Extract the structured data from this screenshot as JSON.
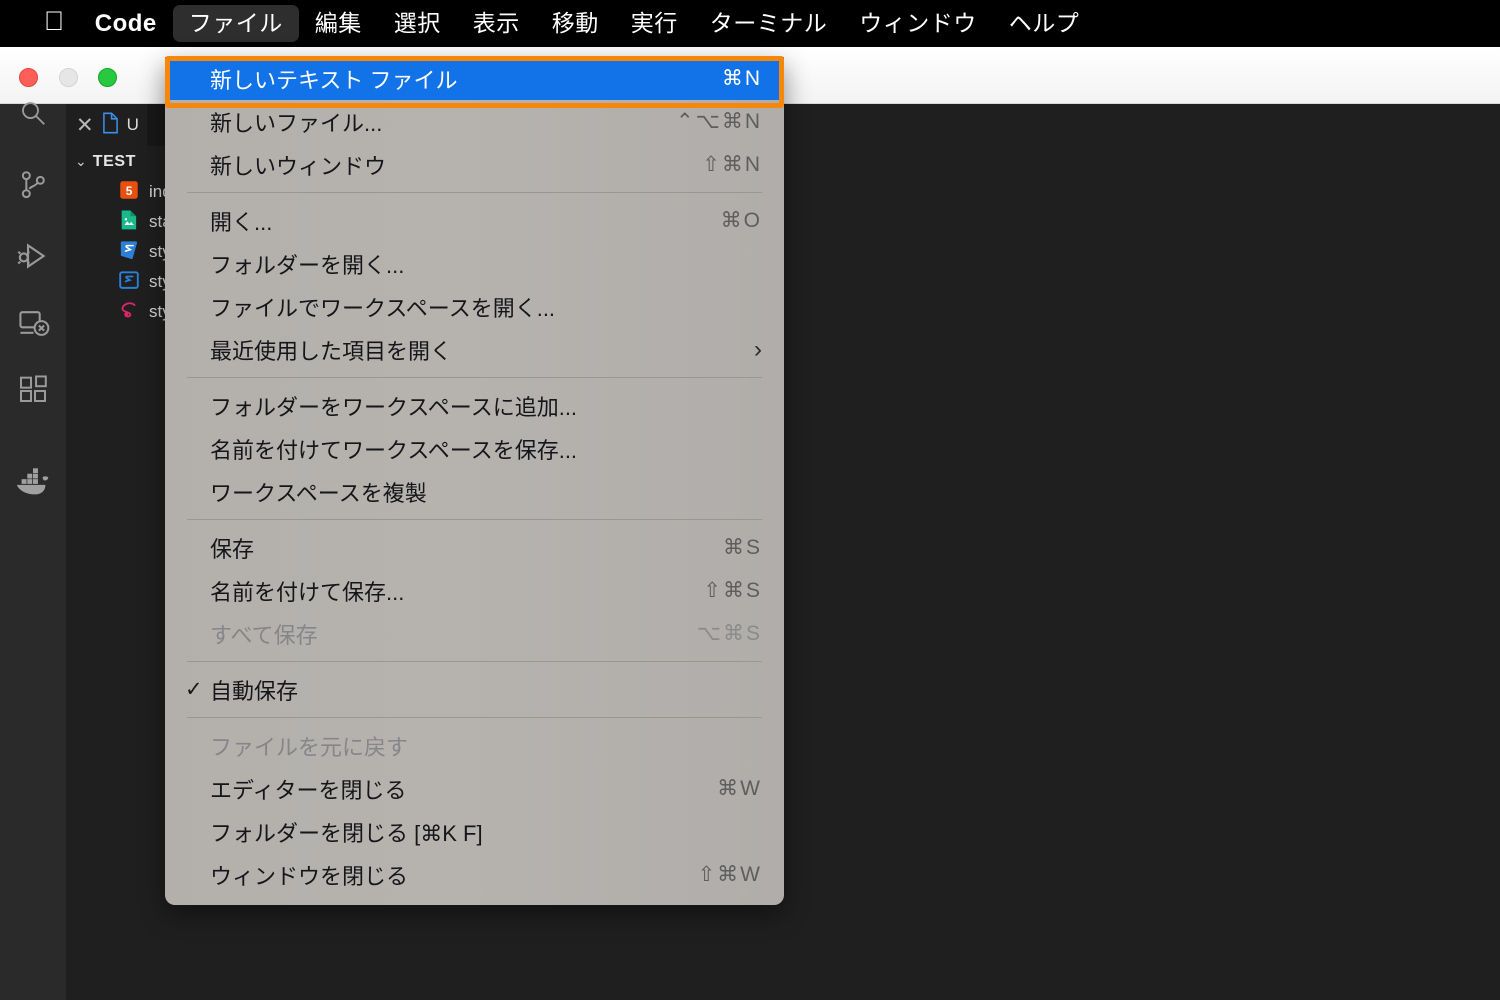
{
  "menubar": {
    "apple_icon": "apple-logo-icon",
    "items": [
      {
        "label": "Code",
        "strong": true,
        "active": false
      },
      {
        "label": "ファイル",
        "strong": false,
        "active": true
      },
      {
        "label": "編集",
        "strong": false,
        "active": false
      },
      {
        "label": "選択",
        "strong": false,
        "active": false
      },
      {
        "label": "表示",
        "strong": false,
        "active": false
      },
      {
        "label": "移動",
        "strong": false,
        "active": false
      },
      {
        "label": "実行",
        "strong": false,
        "active": false
      },
      {
        "label": "ターミナル",
        "strong": false,
        "active": false
      },
      {
        "label": "ウィンドウ",
        "strong": false,
        "active": false
      },
      {
        "label": "ヘルプ",
        "strong": false,
        "active": false
      }
    ]
  },
  "window": {
    "traffic_lights": [
      "close-button",
      "minimize-button",
      "zoom-button"
    ],
    "tab": {
      "close_icon": "✕",
      "file_icon": "text-file-icon",
      "label": "U"
    }
  },
  "activitybar": {
    "icons": [
      "search-icon",
      "source-control-icon",
      "run-and-debug-icon",
      "remote-explorer-icon",
      "extensions-icon",
      "docker-icon"
    ]
  },
  "explorer": {
    "chevron": "⌄",
    "folder_label": "TEST",
    "files": [
      {
        "name": "ind",
        "icon": "html5-file-icon"
      },
      {
        "name": "sta",
        "icon": "image-file-icon"
      },
      {
        "name": "sty",
        "icon": "css-file-icon"
      },
      {
        "name": "sty",
        "icon": "less-file-icon"
      },
      {
        "name": "sty",
        "icon": "sass-file-icon"
      }
    ]
  },
  "file_menu": {
    "highlight_color": "#1273e8",
    "annotation_color": "#f5880a",
    "items": [
      {
        "type": "item",
        "label": "新しいテキスト ファイル",
        "accel": "⌘N",
        "state": "highlighted"
      },
      {
        "type": "item",
        "label": "新しいファイル...",
        "accel": "⌃⌥⌘N",
        "state": "normal"
      },
      {
        "type": "item",
        "label": "新しいウィンドウ",
        "accel": "⇧⌘N",
        "state": "normal"
      },
      {
        "type": "separator"
      },
      {
        "type": "item",
        "label": "開く...",
        "accel": "⌘O",
        "state": "normal"
      },
      {
        "type": "item",
        "label": "フォルダーを開く...",
        "accel": "",
        "state": "normal"
      },
      {
        "type": "item",
        "label": "ファイルでワークスペースを開く...",
        "accel": "",
        "state": "normal"
      },
      {
        "type": "item",
        "label": "最近使用した項目を開く",
        "accel": "",
        "state": "normal",
        "submenu": true
      },
      {
        "type": "separator"
      },
      {
        "type": "item",
        "label": "フォルダーをワークスペースに追加...",
        "accel": "",
        "state": "normal"
      },
      {
        "type": "item",
        "label": "名前を付けてワークスペースを保存...",
        "accel": "",
        "state": "normal"
      },
      {
        "type": "item",
        "label": "ワークスペースを複製",
        "accel": "",
        "state": "normal"
      },
      {
        "type": "separator"
      },
      {
        "type": "item",
        "label": "保存",
        "accel": "⌘S",
        "state": "normal"
      },
      {
        "type": "item",
        "label": "名前を付けて保存...",
        "accel": "⇧⌘S",
        "state": "normal"
      },
      {
        "type": "item",
        "label": "すべて保存",
        "accel": "⌥⌘S",
        "state": "disabled"
      },
      {
        "type": "separator"
      },
      {
        "type": "item",
        "label": "自動保存",
        "accel": "",
        "state": "normal",
        "checked": true
      },
      {
        "type": "separator"
      },
      {
        "type": "item",
        "label": "ファイルを元に戻す",
        "accel": "",
        "state": "disabled"
      },
      {
        "type": "item",
        "label": "エディターを閉じる",
        "accel": "⌘W",
        "state": "normal"
      },
      {
        "type": "item",
        "label": "フォルダーを閉じる [⌘K F]",
        "accel": "",
        "state": "normal"
      },
      {
        "type": "item",
        "label": "ウィンドウを閉じる",
        "accel": "⇧⌘W",
        "state": "normal"
      }
    ]
  }
}
